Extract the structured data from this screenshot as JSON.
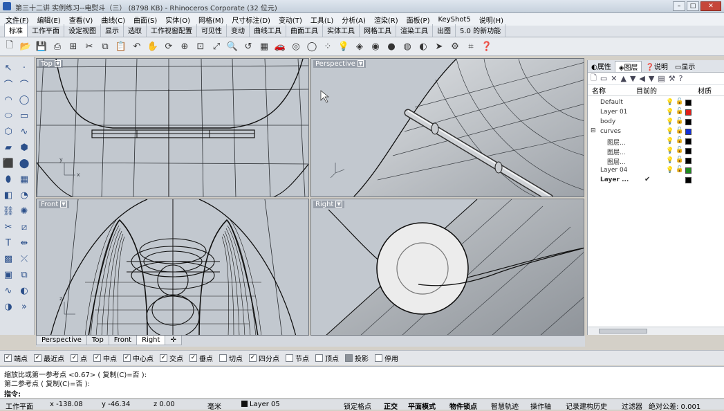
{
  "window": {
    "title": "第三十二讲 实例练习--电熨斗（三）  (8798 KB) - Rhinoceros Corporate (32 位元)"
  },
  "menu": [
    "文件(F)",
    "编辑(E)",
    "查看(V)",
    "曲线(C)",
    "曲面(S)",
    "实体(O)",
    "网格(M)",
    "尺寸标注(D)",
    "变动(T)",
    "工具(L)",
    "分析(A)",
    "渲染(R)",
    "面板(P)",
    "KeyShot5",
    "说明(H)"
  ],
  "tabs": [
    "标准",
    "工作平面",
    "设定视图",
    "显示",
    "选取",
    "工作视窗配置",
    "可见性",
    "变动",
    "曲线工具",
    "曲面工具",
    "实体工具",
    "网格工具",
    "渲染工具",
    "出图",
    "5.0 的新功能"
  ],
  "toolbar_icons": [
    "new-file-icon",
    "open-folder-icon",
    "save-icon",
    "print-icon",
    "import-icon",
    "cut-icon",
    "copy-icon",
    "paste-icon",
    "undo-icon",
    "pan-hand-icon",
    "rotate-view-icon",
    "zoom-dynamic-icon",
    "zoom-window-icon",
    "zoom-extents-icon",
    "zoom-selected-icon",
    "undo-view-icon",
    "four-viewports-icon",
    "car-icon",
    "set-view-icon",
    "circle-select-icon",
    "point-edit-icon",
    "light-bulb-icon",
    "layer-icon",
    "material-icon",
    "render-sphere-icon",
    "color-sphere-icon",
    "render-preview-icon",
    "arrow-icon",
    "gear-icon",
    "edit-points-icon",
    "help-icon"
  ],
  "viewports": {
    "top": "Top",
    "perspective": "Perspective",
    "front": "Front",
    "right": "Right"
  },
  "viewport_tabs": [
    "Perspective",
    "Top",
    "Front",
    "Right"
  ],
  "panel": {
    "tabs": [
      "属性",
      "图层",
      "说明",
      "显示"
    ],
    "col_name": "名称",
    "col_current": "目前的",
    "col_material": "材质",
    "layers": [
      {
        "name": "Default",
        "color": "#000000",
        "indent": 0,
        "bulb": "blue"
      },
      {
        "name": "Layer 01",
        "color": "#e0201a",
        "indent": 0,
        "bulb": "blue"
      },
      {
        "name": "body",
        "color": "#000000",
        "indent": 0,
        "bulb": "blue"
      },
      {
        "name": "curves",
        "color": "#1230d8",
        "indent": 0,
        "bulb": "yellow",
        "expand": "⊟"
      },
      {
        "name": "图层...",
        "color": "#000000",
        "indent": 1,
        "bulb": "blue"
      },
      {
        "name": "图层...",
        "color": "#000000",
        "indent": 1,
        "bulb": "yellow"
      },
      {
        "name": "图层...",
        "color": "#000000",
        "indent": 1,
        "bulb": "yellow"
      },
      {
        "name": "Layer 04",
        "color": "#1e8a1e",
        "indent": 0,
        "bulb": "blue"
      },
      {
        "name": "Layer ...",
        "color": "#000000",
        "indent": 0,
        "current": "✔",
        "bold": true
      }
    ]
  },
  "osnaps": [
    {
      "label": "端点",
      "checked": true
    },
    {
      "label": "最近点",
      "checked": true
    },
    {
      "label": "点",
      "checked": true
    },
    {
      "label": "中点",
      "checked": true
    },
    {
      "label": "中心点",
      "checked": true
    },
    {
      "label": "交点",
      "checked": true
    },
    {
      "label": "垂点",
      "checked": true
    },
    {
      "label": "切点",
      "checked": false
    },
    {
      "label": "四分点",
      "checked": true
    },
    {
      "label": "节点",
      "checked": false
    },
    {
      "label": "顶点",
      "checked": false
    },
    {
      "label": "投影",
      "checked": false,
      "proj": true
    },
    {
      "label": "停用",
      "checked": false
    }
  ],
  "command": {
    "line1": "缩放比或第一参考点 <0.67> ( 复制(C)=否 ):",
    "line2": "第二参考点 ( 复制(C)=否 ):",
    "prompt": "指令:"
  },
  "status": {
    "cplane": "工作平面",
    "x": "x -138.08",
    "y": "y -46.34",
    "z": "z 0.00",
    "units": "毫米",
    "layer": "Layer 05",
    "grid_snap": "锁定格点",
    "ortho": "正交",
    "planar": "平面模式",
    "osnap": "物件锁点",
    "smarttrack": "智慧轨迹",
    "gumball": "操作轴",
    "history": "记录建构历史",
    "filter": "过滤器",
    "tolerance": "绝对公差: 0.001"
  }
}
